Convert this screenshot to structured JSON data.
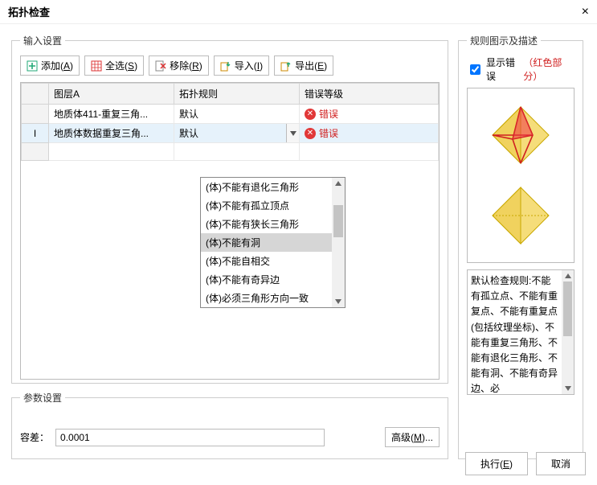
{
  "window": {
    "title": "拓扑检查",
    "close": "×"
  },
  "input_section": {
    "legend": "输入设置",
    "toolbar": {
      "add": {
        "label": "添加",
        "key": "A"
      },
      "all": {
        "label": "全选",
        "key": "S"
      },
      "remove": {
        "label": "移除",
        "key": "R"
      },
      "import": {
        "label": "导入",
        "key": "I"
      },
      "export": {
        "label": "导出",
        "key": "E"
      }
    },
    "columns": {
      "layer": "图层A",
      "rule": "拓扑规则",
      "level": "错误等级"
    },
    "rows": [
      {
        "marker": "",
        "layer": "地质体411-重复三角...",
        "rule": "默认",
        "level": "错误",
        "selected": false,
        "dropdown": false
      },
      {
        "marker": "I",
        "layer": "地质体数据重复三角...",
        "rule": "默认",
        "level": "错误",
        "selected": true,
        "dropdown": true
      }
    ],
    "dropdown_items": [
      "(体)不能有退化三角形",
      "(体)不能有孤立顶点",
      "(体)不能有狭长三角形",
      "(体)不能有洞",
      "(体)不能自相交",
      "(体)不能有奇异边",
      "(体)必须三角形方向一致"
    ],
    "dropdown_hl_index": 3
  },
  "param_section": {
    "legend": "参数设置",
    "tol_label": "容差：",
    "tol_value": "0.0001",
    "adv": {
      "label": "高级",
      "key": "M"
    }
  },
  "rule_section": {
    "legend": "规则图示及描述",
    "show_err_label": "显示错误",
    "show_err_suffix": "（红色部分）",
    "show_err_checked": true,
    "description": "默认检查规则:不能有孤立点、不能有重复点、不能有重复点(包括纹理坐标)、不能有重复三角形、不能有退化三角形、不能有洞、不能有奇异边、必"
  },
  "footer": {
    "run": {
      "label": "执行",
      "key": "E"
    },
    "cancel": {
      "label": "取消"
    }
  }
}
